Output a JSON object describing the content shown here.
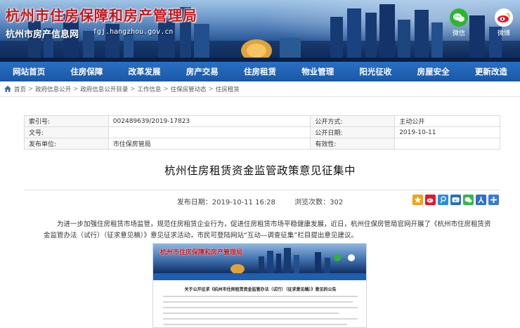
{
  "header": {
    "title": "杭州市住房保障和房产管理局",
    "subtitle": "杭州市房产信息网",
    "url": "fgj.hangzhou.gov.cn",
    "social": [
      {
        "name": "wechat-icon",
        "label": "微信",
        "color": "#2fb52f"
      },
      {
        "name": "weibo-icon",
        "label": "微博",
        "color": "#e6162d"
      }
    ]
  },
  "nav": [
    "网站首页",
    "住房保障",
    "改革发展",
    "房产交易",
    "住房租赁",
    "物业管理",
    "阳光征收",
    "房屋安全",
    "更新改造"
  ],
  "breadcrumb": [
    "首页",
    "政府信息公开",
    "政府信息公开目录",
    "工作信息",
    "住保房管动态",
    "住房租赁"
  ],
  "meta": {
    "index_label": "索引号:",
    "index_value": "002489639/2019-17823",
    "doc_label": "文号:",
    "doc_value": "",
    "issuer_label": "发布单位:",
    "issuer_value": "市住保房管局",
    "public_mode_label": "公开方式:",
    "public_mode_value": "主动公开",
    "public_date_label": "公开日期:",
    "public_date_value": "2019-10-11",
    "validity_label": "有效性:",
    "validity_value": ""
  },
  "article": {
    "title": "杭州住房租赁资金监管政策意见征集中",
    "publish": "发布日期：2019-10-11 16:28",
    "views": "浏览次数：302",
    "paragraph": "为进一步加强住房租赁市场监管，规范住房租赁企业行为，促进住房租赁市场平稳健康发展，近日，杭州住保房管局官网开展了《杭州市住房租赁资金监管办法（试行）（征求意见稿）》意见征求活动，市民可登陆网站“互动—调查征集”栏目提出意见建议。"
  },
  "share_icons": [
    {
      "name": "qzone-share-icon",
      "color": "#f0a21a",
      "glyph": "★"
    },
    {
      "name": "weibo-share-icon",
      "color": "#e6162d",
      "glyph": "微"
    },
    {
      "name": "tencent-weibo-share-icon",
      "color": "#2a8fd6",
      "glyph": "腾"
    },
    {
      "name": "renren-share-icon",
      "color": "#2b6fb9",
      "glyph": "ai"
    },
    {
      "name": "wechat-share-icon",
      "color": "#3bb54a",
      "glyph": "✆"
    },
    {
      "name": "people-share-icon",
      "color": "#2d6fcc",
      "glyph": "人"
    },
    {
      "name": "more-share-icon",
      "color": "#3a7ad0",
      "glyph": "+"
    }
  ],
  "embed": {
    "title": "杭州市住房保障和房产管理局",
    "heading": "关于公开征求《杭州市住房租赁资金监管办法（试行）（征求意见稿）》意见的公告"
  }
}
